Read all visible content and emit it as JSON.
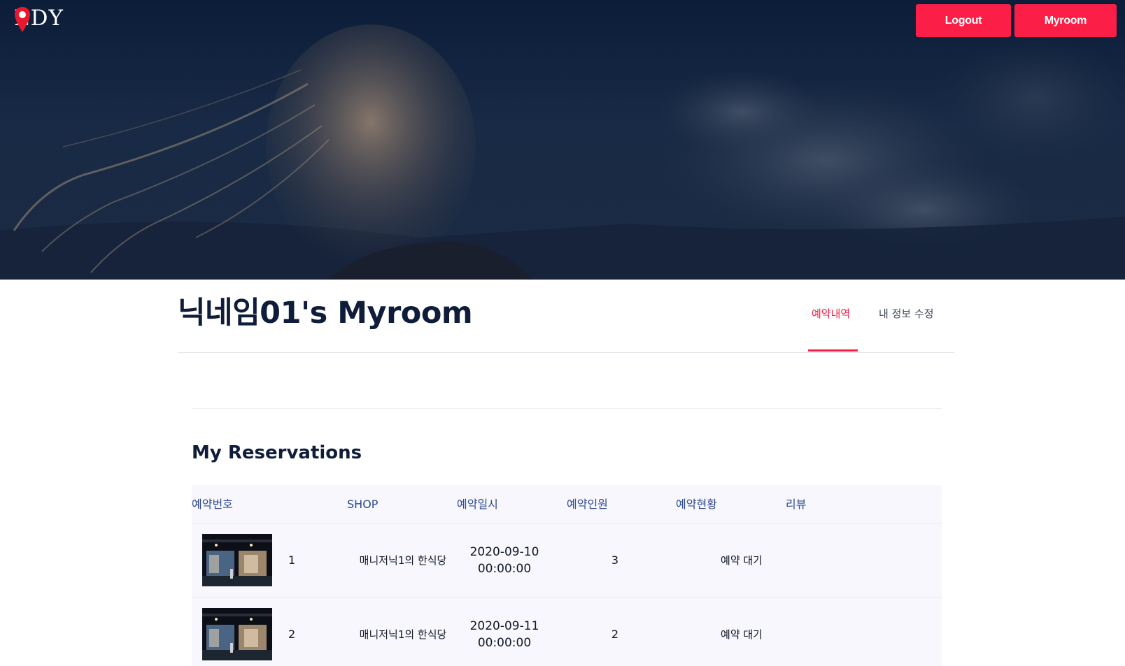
{
  "header": {
    "logo_text_left": "E",
    "logo_text_right": "DY",
    "logo_icon": "map-pin-icon",
    "buttons": {
      "logout": "Logout",
      "myroom": "Myroom"
    }
  },
  "page": {
    "title": "닉네임01's Myroom",
    "tabs": {
      "reservations": "예약내역",
      "edit_info": "내 정보 수정"
    },
    "active_tab": "reservations"
  },
  "reservations": {
    "title": "My Reservations",
    "columns": {
      "no": "예약번호",
      "shop": "SHOP",
      "datetime": "예약일시",
      "people": "예약인원",
      "status": "예약현황",
      "review": "리뷰"
    },
    "rows": [
      {
        "no": "1",
        "shop": "매니저닉1의 한식당",
        "date": "2020-09-10",
        "time": "00:00:00",
        "people": "3",
        "status": "예약 대기",
        "review": ""
      },
      {
        "no": "2",
        "shop": "매니저닉1의 한식당",
        "date": "2020-09-11",
        "time": "00:00:00",
        "people": "2",
        "status": "예약 대기",
        "review": ""
      }
    ]
  },
  "colors": {
    "accent": "#fb1f47",
    "heading": "#0f1d3a",
    "column_header": "#2f4a8f",
    "hero_overlay": "#0b1d38"
  }
}
